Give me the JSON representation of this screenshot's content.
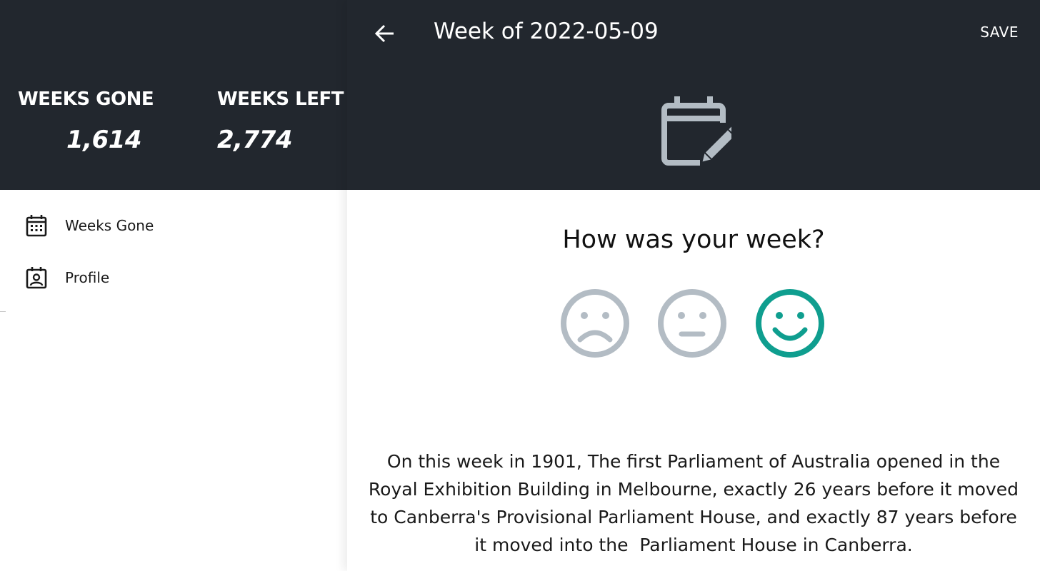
{
  "sidebar": {
    "stats": {
      "gone_label": "WEEKS GONE",
      "gone_value": "1,614",
      "left_label": "WEEKS LEFT",
      "left_value": "2,774"
    },
    "nav": [
      {
        "label": "Weeks Gone",
        "icon": "calendar-icon"
      },
      {
        "label": "Profile",
        "icon": "contact-card-icon"
      }
    ]
  },
  "header": {
    "title": "Week of 2022-05-09",
    "save_label": "SAVE",
    "back_icon": "back-arrow-icon",
    "main_icon": "calendar-edit-icon"
  },
  "main": {
    "question": "How was your week?",
    "moods": [
      {
        "name": "sad",
        "icon": "sad-face-icon",
        "selected": false
      },
      {
        "name": "neutral",
        "icon": "neutral-face-icon",
        "selected": false
      },
      {
        "name": "happy",
        "icon": "happy-face-icon",
        "selected": true
      }
    ],
    "fact": "On this week in 1901, The first Parliament of Australia opened in the Royal Exhibition Building in Melbourne, exactly 26 years before it moved to Canberra's Provisional Parliament House, and exactly 87 years before it moved into the  Parliament House in Canberra."
  },
  "colors": {
    "header_bg": "#22272e",
    "mood_inactive": "#b3bcc4",
    "mood_selected": "#0f9e8f",
    "icon_gray": "#b3bcc4"
  }
}
